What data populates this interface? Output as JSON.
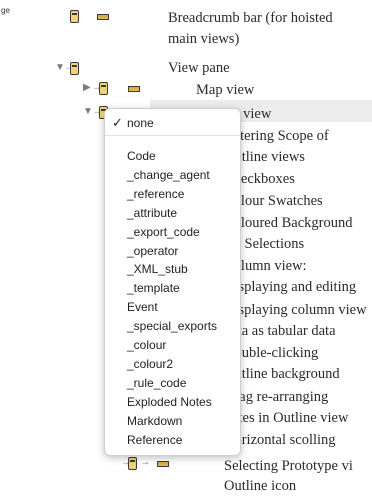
{
  "gutter_label": "ge",
  "rows": [
    {
      "text": "Breadcrumb bar (for hoisted"
    },
    {
      "text": "main views)"
    },
    {
      "text": "View pane"
    },
    {
      "text": "Map view"
    },
    {
      "text": "Outline view"
    },
    {
      "text": "Filtering Scope of"
    },
    {
      "text": "Outline views"
    },
    {
      "text": "Checkboxes"
    },
    {
      "text": "Colour Swatches"
    },
    {
      "text": "Coloured Background"
    },
    {
      "text": "for Selections"
    },
    {
      "text": "Column view:"
    },
    {
      "text": "Displaying and editing"
    },
    {
      "text": "Displaying column view"
    },
    {
      "text": "data as tabular data"
    },
    {
      "text": "Double-clicking"
    },
    {
      "text": "Outline background"
    },
    {
      "text": "Drag re-arranging"
    },
    {
      "text": "notes in Outline view"
    },
    {
      "text": "Horizontal scolling"
    },
    {
      "text": "Selecting Prototype vi"
    },
    {
      "text": "Outline icon"
    }
  ],
  "menu": {
    "checked_item": "none",
    "items": [
      "Code",
      "_change_agent",
      "_reference",
      "_attribute",
      "_export_code",
      "_operator",
      "_XML_stub",
      "_template",
      "Event",
      "_special_exports",
      "_colour",
      "_colour2",
      "_rule_code",
      "Exploded Notes",
      "Markdown",
      "Reference"
    ]
  }
}
